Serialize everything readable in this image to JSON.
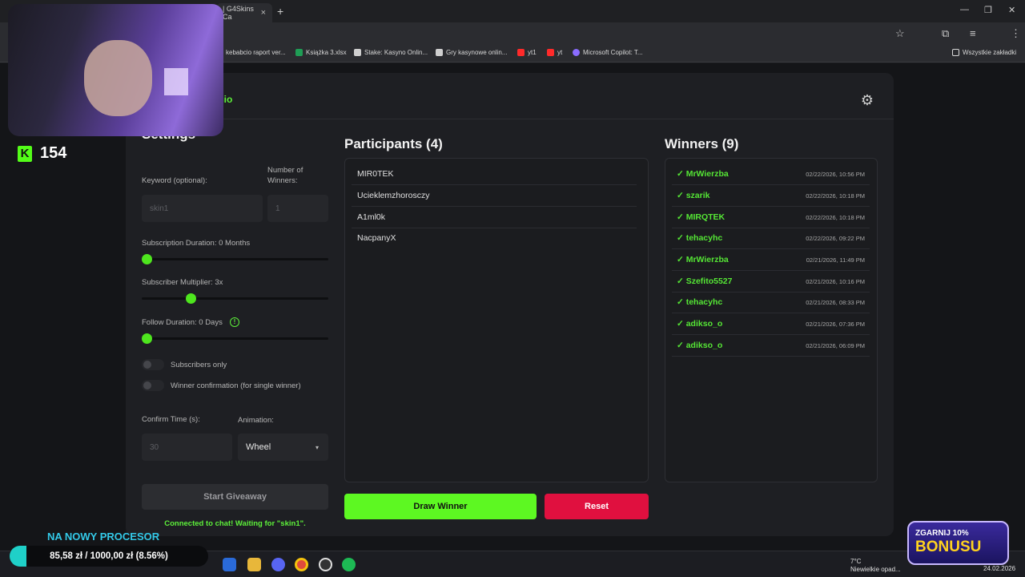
{
  "browser": {
    "tabs": [
      {
        "label": "| G4Skins Ca",
        "close": "×"
      }
    ],
    "new_tab": "+",
    "window_controls": {
      "minimize": "—",
      "restore": "❐",
      "close": "✕"
    },
    "bookmarks": [
      {
        "label": "kebabcio raport ver...",
        "color": "#3aa0ff"
      },
      {
        "label": "Książka 3.xlsx",
        "color": "#1f9d55"
      },
      {
        "label": "Stake: Kasyno Onlin...",
        "color": "#cfcfcf"
      },
      {
        "label": "Gry kasynowe onlin...",
        "color": "#cfcfcf"
      },
      {
        "label": "yt1",
        "color": "#ff2a2a"
      },
      {
        "label": "yt",
        "color": "#ff2a2a"
      },
      {
        "label": "Microsoft Copilot: T...",
        "color": "#8a6cff"
      }
    ],
    "all_bookmarks": "Wszystkie zakładki"
  },
  "app": {
    "brand": "abcio",
    "settings": {
      "title": "Settings",
      "keyword_label": "Keyword (optional):",
      "keyword_placeholder": "skin1",
      "winners_label": "Number of Winners:",
      "winners_placeholder": "1",
      "sub_duration_label": "Subscription Duration: 0 Months",
      "sub_duration_value": 0,
      "sub_multiplier_label": "Subscriber Multiplier: 3x",
      "sub_multiplier_value": 0.25,
      "follow_duration_label": "Follow Duration: 0 Days",
      "follow_duration_value": 0,
      "subs_only_label": "Subscribers only",
      "winner_confirm_label": "Winner confirmation (for single winner)",
      "confirm_time_label": "Confirm Time (s):",
      "confirm_time_placeholder": "30",
      "animation_label": "Animation:",
      "animation_value": "Wheel",
      "start_button": "Start Giveaway",
      "status": "Connected to chat! Waiting for \"skin1\"."
    },
    "participants": {
      "title": "Participants (4)",
      "items": [
        "MIR0TEK",
        "Ucieklemzhorosczy",
        "A1ml0k",
        "NacpanyX"
      ]
    },
    "winners": {
      "title": "Winners (9)",
      "items": [
        {
          "name": "✓ MrWierzba",
          "time": "02/22/2026, 10:56 PM"
        },
        {
          "name": "✓ szarik",
          "time": "02/22/2026, 10:18 PM"
        },
        {
          "name": "✓ MIRQTEK",
          "time": "02/22/2026, 10:18 PM"
        },
        {
          "name": "✓ tehacyhc",
          "time": "02/22/2026, 09:22 PM"
        },
        {
          "name": "✓ MrWierzba",
          "time": "02/21/2026, 11:49 PM"
        },
        {
          "name": "✓ Szefito5527",
          "time": "02/21/2026, 10:16 PM"
        },
        {
          "name": "✓ tehacyhc",
          "time": "02/21/2026, 08:33 PM"
        },
        {
          "name": "✓ adikso_o",
          "time": "02/21/2026, 07:36 PM"
        },
        {
          "name": "✓ adikso_o",
          "time": "02/21/2026, 06:09 PM"
        }
      ]
    },
    "draw_button": "Draw Winner",
    "reset_button": "Reset",
    "colors": {
      "accent": "#5df03a",
      "danger": "#e0103f"
    }
  },
  "stream": {
    "viewer_count": "154",
    "goal_title": "NA NOWY PROCESOR",
    "goal_text": "85,58 zł / 1000,00 zł (8.56%)",
    "goal_progress": 0.0856,
    "bonus_line1": "ZGARNIJ 10%",
    "bonus_line2": "BONUSU"
  },
  "taskbar": {
    "weather_temp": "7°C",
    "weather_text": "Niewielkie opad...",
    "date": "24.02.2026"
  }
}
